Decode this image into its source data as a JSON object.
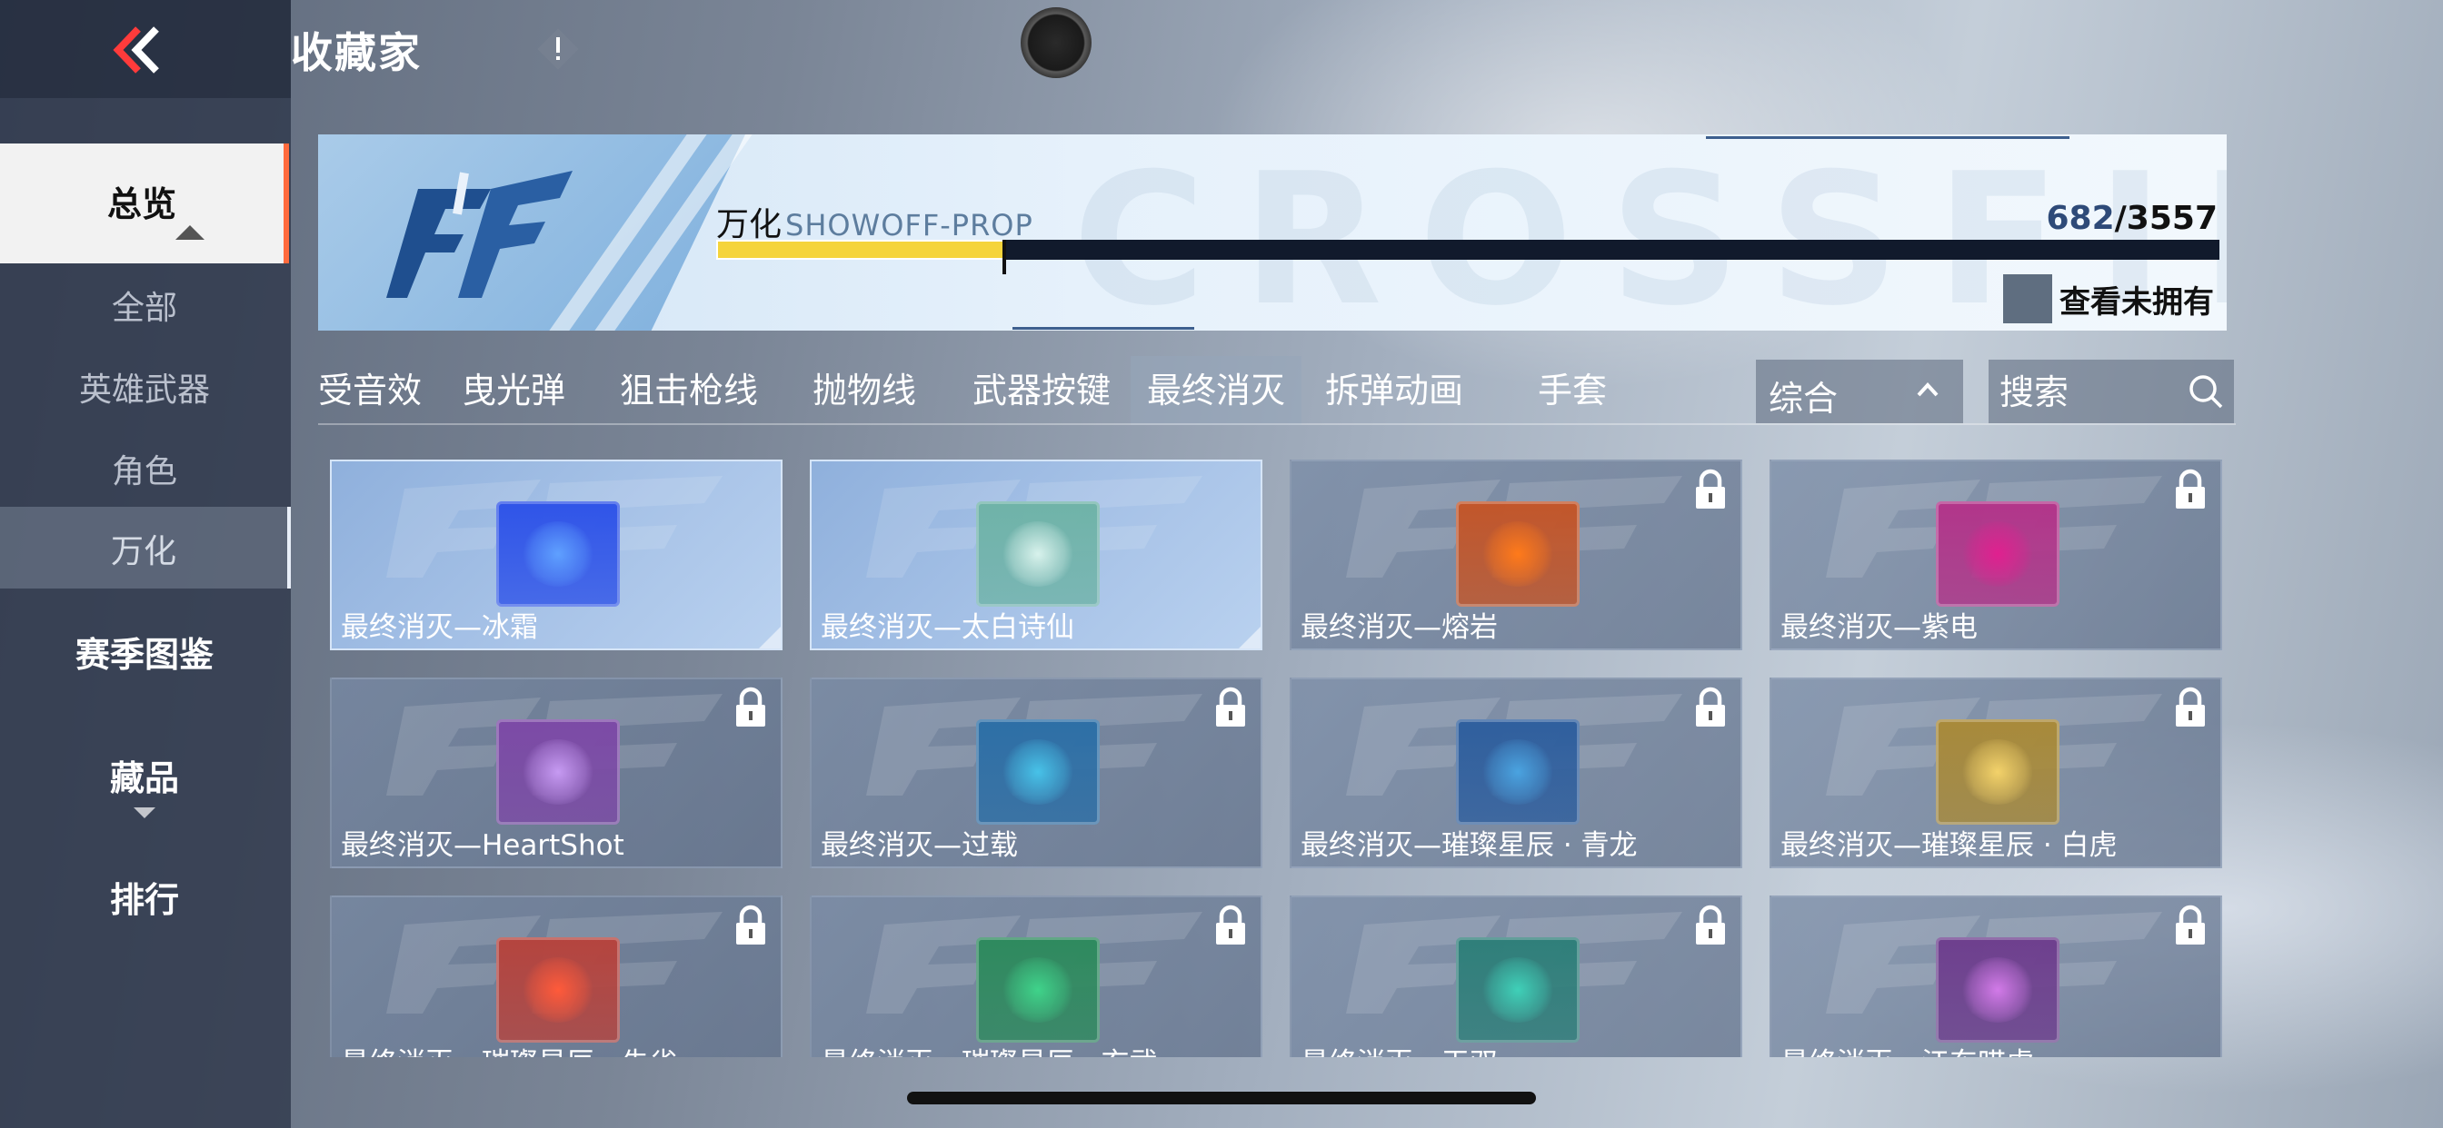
{
  "header": {
    "title": "收藏家"
  },
  "sidebar": {
    "items": [
      {
        "label": "总览",
        "type": "active"
      },
      {
        "label": "全部",
        "type": "sub"
      },
      {
        "label": "英雄武器",
        "type": "sub"
      },
      {
        "label": "角色",
        "type": "sub"
      },
      {
        "label": "万化",
        "type": "sub-selected"
      },
      {
        "label": "赛季图鉴",
        "type": "main"
      },
      {
        "label": "藏品",
        "type": "main"
      },
      {
        "label": "排行",
        "type": "main"
      }
    ]
  },
  "banner": {
    "label": "万化",
    "label_sub": "SHOWOFF-PROP",
    "owned": "682",
    "total": "3557",
    "progress_fraction": 0.1917,
    "view_unowned_label": "查看未拥有",
    "watermark": "CROSSFIRE"
  },
  "tabs": {
    "items": [
      "受音效",
      "曳光弹",
      "狙击枪线",
      "抛物线",
      "武器按键",
      "最终消灭",
      "拆弹动画",
      "手套"
    ],
    "active_index": 5
  },
  "sort": {
    "label": "综合"
  },
  "search": {
    "placeholder": "搜索"
  },
  "cards": [
    {
      "name": "最终消灭—冰霜",
      "owned": true,
      "color": "#2f54e8",
      "glow": "#5fa0ff"
    },
    {
      "name": "最终消灭—太白诗仙",
      "owned": true,
      "color": "#6fb3a8",
      "glow": "#d8f2ec"
    },
    {
      "name": "最终消灭—熔岩",
      "owned": false,
      "color": "#c2562a",
      "glow": "#ff7a1a"
    },
    {
      "name": "最终消灭—紫电",
      "owned": false,
      "color": "#b2358a",
      "glow": "#e0208f"
    },
    {
      "name": "最终消灭—HeartShot",
      "owned": false,
      "color": "#7c4aa6",
      "glow": "#c69af2"
    },
    {
      "name": "最终消灭—过载",
      "owned": false,
      "color": "#2d6fa6",
      "glow": "#47c2e8"
    },
    {
      "name": "最终消灭—璀璨星辰 · 青龙",
      "owned": false,
      "color": "#2f5f9e",
      "glow": "#4aa3e0"
    },
    {
      "name": "最终消灭—璀璨星辰 · 白虎",
      "owned": false,
      "color": "#a88a3a",
      "glow": "#f3d26a"
    },
    {
      "name": "最终消灭—璀璨星辰 · 朱雀",
      "owned": false,
      "color": "#b5443e",
      "glow": "#ff5a3a"
    },
    {
      "name": "最终消灭—璀璨星辰 · 玄武",
      "owned": false,
      "color": "#2e8a5e",
      "glow": "#3fd38a"
    },
    {
      "name": "最终消灭—天双",
      "owned": false,
      "color": "#2f7f7a",
      "glow": "#3fd0b8"
    },
    {
      "name": "最终消灭—江东呓虎",
      "owned": false,
      "color": "#6e3f8e",
      "glow": "#d27ae8"
    }
  ]
}
